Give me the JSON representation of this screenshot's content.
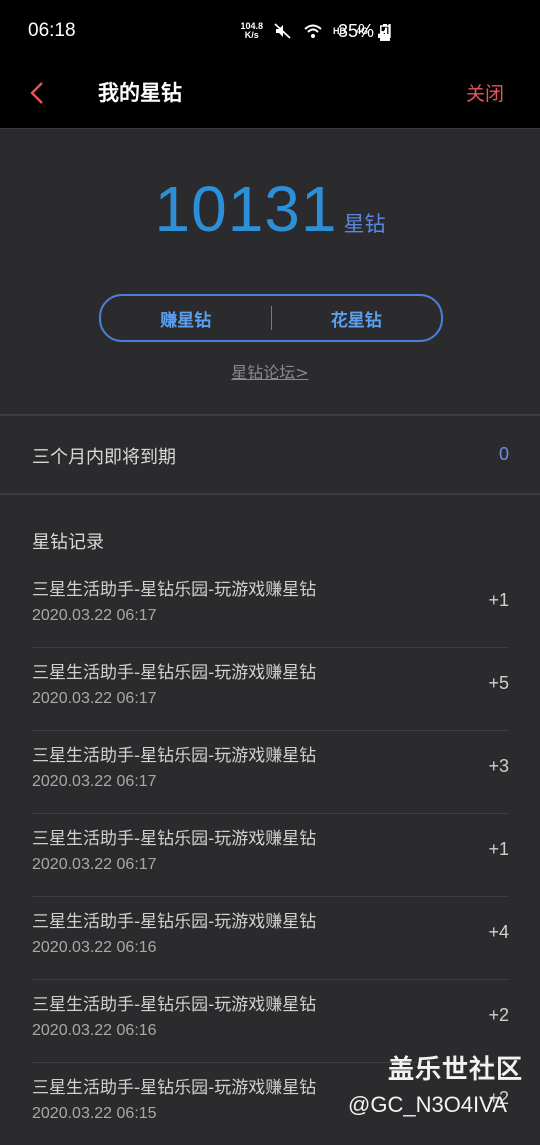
{
  "status_bar": {
    "time": "06:18",
    "net_speed_value": "104.8",
    "net_speed_unit": "K/s",
    "hd_label": "HD",
    "network_type": "4G",
    "battery_percent": "35%",
    "icons": [
      "mute-icon",
      "wifi-icon",
      "signal-icon",
      "battery-charging-icon"
    ]
  },
  "app_bar": {
    "title": "我的星钻",
    "close_label": "关闭",
    "accent_color": "#e8545a"
  },
  "balance": {
    "amount": "10131",
    "unit": "星钻",
    "color": "#2d8fd8"
  },
  "actions": {
    "earn_label": "赚星钻",
    "spend_label": "花星钻"
  },
  "forum_link": "星钻论坛>",
  "expiring": {
    "label": "三个月内即将到期",
    "value": "0"
  },
  "records": {
    "title": "星钻记录",
    "items": [
      {
        "title": "三星生活助手-星钻乐园-玩游戏赚星钻",
        "time": "2020.03.22 06:17",
        "amount": "+1"
      },
      {
        "title": "三星生活助手-星钻乐园-玩游戏赚星钻",
        "time": "2020.03.22 06:17",
        "amount": "+5"
      },
      {
        "title": "三星生活助手-星钻乐园-玩游戏赚星钻",
        "time": "2020.03.22 06:17",
        "amount": "+3"
      },
      {
        "title": "三星生活助手-星钻乐园-玩游戏赚星钻",
        "time": "2020.03.22 06:17",
        "amount": "+1"
      },
      {
        "title": "三星生活助手-星钻乐园-玩游戏赚星钻",
        "time": "2020.03.22 06:16",
        "amount": "+4"
      },
      {
        "title": "三星生活助手-星钻乐园-玩游戏赚星钻",
        "time": "2020.03.22 06:16",
        "amount": "+2"
      },
      {
        "title": "三星生活助手-星钻乐园-玩游戏赚星钻",
        "time": "2020.03.22 06:15",
        "amount": "+2"
      }
    ]
  },
  "watermark": {
    "title": "盖乐世社区",
    "user": "@GC_N3O4IVA"
  }
}
